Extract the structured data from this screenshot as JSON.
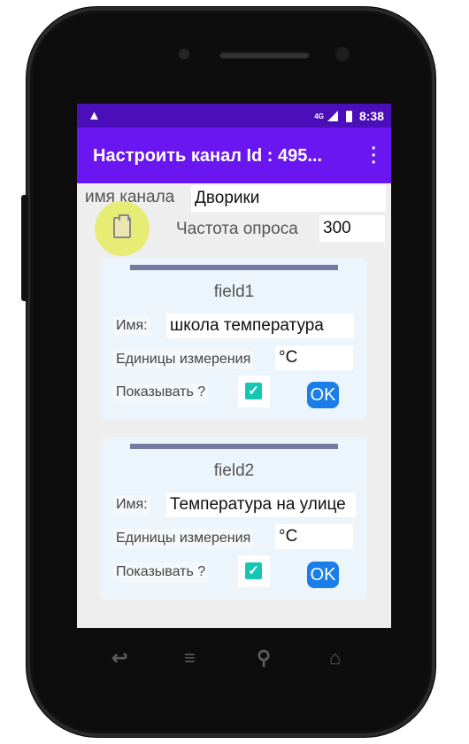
{
  "status_bar": {
    "warning_icon": "warning-icon",
    "network": "4G",
    "time": "8:38"
  },
  "app_bar": {
    "title": "Настроить канал  Id : 495...",
    "menu_icon": "more-vert-icon"
  },
  "channel": {
    "name_label": "имя канала",
    "name_value": "Дворики",
    "poll_label": "Частота опроса",
    "poll_value": "300"
  },
  "fields": [
    {
      "title": "field1",
      "name_label": "Имя:",
      "name_value": "школа температура",
      "units_label": "Единицы измерения",
      "units_value": "°C",
      "show_label": "Показывать ?",
      "show_checked": true,
      "ok_label": "OK"
    },
    {
      "title": "field2",
      "name_label": "Имя:",
      "name_value": "Температура на улице",
      "units_label": "Единицы измерения",
      "units_value": "°C",
      "show_label": "Показывать ?",
      "show_checked": true,
      "ok_label": "OK"
    }
  ],
  "colors": {
    "status_bar": "#4a0fb8",
    "app_bar": "#6a16f0",
    "checkbox": "#14c7b4",
    "ok_button": "#1b7de8",
    "fab": "#e6ec60"
  }
}
